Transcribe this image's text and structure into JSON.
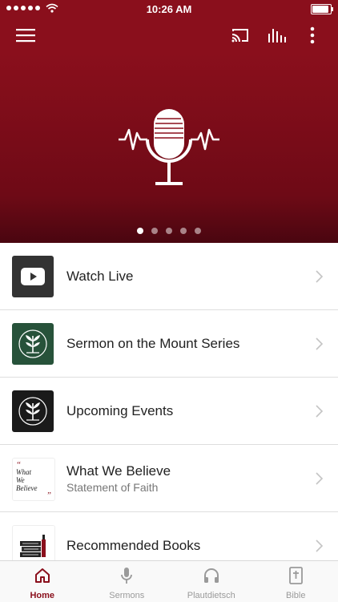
{
  "status_bar": {
    "time": "10:26 AM",
    "battery_level": 1.0
  },
  "toolbar": {
    "menu_icon": "hamburger-menu-icon",
    "actions": [
      {
        "icon": "cast-icon"
      },
      {
        "icon": "audio-levels-icon"
      },
      {
        "icon": "more-vertical-icon"
      }
    ]
  },
  "hero": {
    "icon": "microphone-waveform-icon",
    "pages": 5,
    "active_page": 1
  },
  "list": {
    "items": [
      {
        "title": "Watch Live",
        "subtitle": "",
        "thumb": "youtube-play-icon",
        "thumb_bg": "#333333"
      },
      {
        "title": "Sermon on the Mount Series",
        "subtitle": "",
        "thumb": "sprout-seal-icon",
        "thumb_bg": "#27523a"
      },
      {
        "title": "Upcoming Events",
        "subtitle": "",
        "thumb": "sprout-seal-icon",
        "thumb_bg": "#1a1a1a"
      },
      {
        "title": "What We Believe",
        "subtitle": "Statement of Faith",
        "thumb": "what-we-believe-text",
        "thumb_bg": "#ffffff",
        "thumb_text": [
          "What",
          "We",
          "Believe"
        ]
      },
      {
        "title": "Recommended Books",
        "subtitle": "",
        "thumb": "books-icon",
        "thumb_bg": "#ffffff"
      }
    ]
  },
  "tabs": [
    {
      "label": "Home",
      "icon": "home-icon",
      "active": true
    },
    {
      "label": "Sermons",
      "icon": "microphone-icon",
      "active": false
    },
    {
      "label": "Plautdietsch",
      "icon": "headphones-icon",
      "active": false
    },
    {
      "label": "Bible",
      "icon": "bible-icon",
      "active": false
    }
  ],
  "colors": {
    "brand": "#8a0f1c",
    "inactive_tab": "#9a9a9a"
  }
}
